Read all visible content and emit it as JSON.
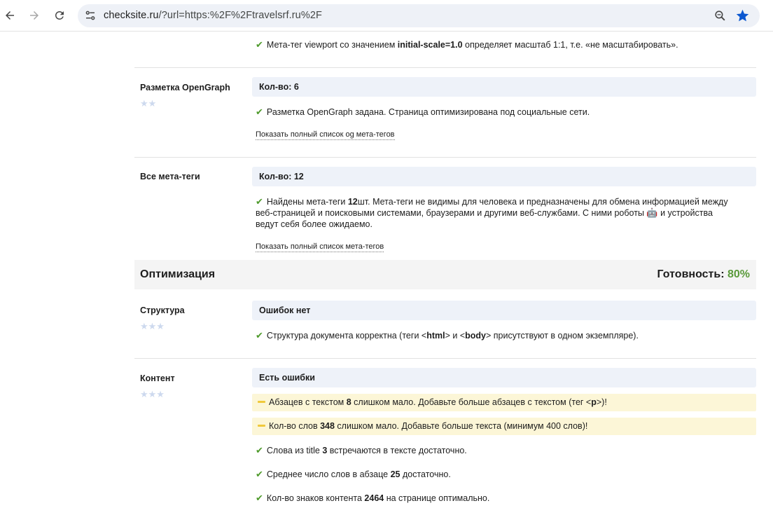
{
  "browser": {
    "url_host": "checksite.ru",
    "url_rest": "/?url=https:%2F%2Ftravelsrf.ru%2F"
  },
  "viewport_check": {
    "text_pre": "Мета-тег viewport со значением ",
    "text_bold": "initial-scale=1.0",
    "text_post": " определяет масштаб 1:1, т.е. «не масштабировать»."
  },
  "opengraph": {
    "title": "Разметка OpenGraph",
    "stars": "★★",
    "badge": "Кол-во: 6",
    "check": "Разметка OpenGraph задана. Страница оптимизирована под социальные сети.",
    "link": "Показать полный список og мета-тегов"
  },
  "all_meta": {
    "title": "Все мета-теги",
    "badge": "Кол-во: 12",
    "check_pre": "Найдены мета-теги ",
    "check_count": "12",
    "check_line1_rest": "шт. Мета-теги не видимы для человека и предназначены для обмена информацией между",
    "check_line2_pre": "веб-страницей и поисковыми системами, браузерами и другими веб-службами. С ними роботы ",
    "check_line2_post": " и устройства",
    "check_line3": "ведут себя более ожидаемо.",
    "link": "Показать полный список мета-тегов"
  },
  "optimization": {
    "title": "Оптимизация",
    "ready_label": "Готовность: ",
    "ready_value": "80%"
  },
  "structure": {
    "title": "Структура",
    "stars": "★★★",
    "badge": "Ошибок нет",
    "check_pre": "Структура документа корректна (теги <",
    "tag1": "html",
    "check_mid1": "> и <",
    "tag2": "body",
    "check_post": "> присутствуют в одном экземпляре)."
  },
  "content": {
    "title": "Контент",
    "stars": "★★★",
    "badge": "Есть ошибки",
    "warn1_pre": "Абзацев с текстом ",
    "warn1_num": "8",
    "warn1_mid": " слишком мало. Добавьте больше абзацев с текстом (тег <",
    "warn1_tag": "p",
    "warn1_post": ">)!",
    "warn2_pre": "Кол-во слов ",
    "warn2_num": "348",
    "warn2_post": " слишком мало. Добавьте больше текста (минимум 400 слов)!",
    "ok1_pre": "Слова из title ",
    "ok1_num": "3",
    "ok1_post": " встречаются в тексте достаточно.",
    "ok2_pre": "Среднее число слов в абзаце ",
    "ok2_num": "25",
    "ok2_post": " достаточно.",
    "ok3_pre": "Кол-во знаков контента ",
    "ok3_num": "2464",
    "ok3_post": " на странице оптимально."
  },
  "icons": {
    "check": "✔",
    "robot": "🤖"
  }
}
